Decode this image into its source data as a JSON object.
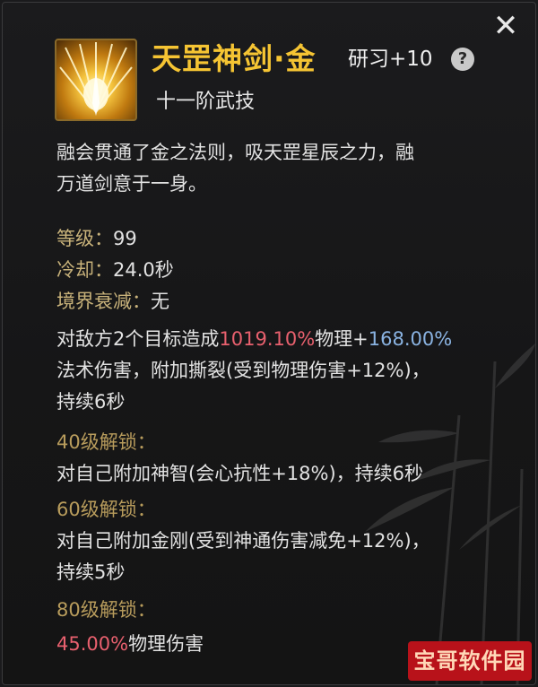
{
  "close_icon": "close-icon",
  "skill": {
    "icon": "golden-sword-burst-icon",
    "name": "天罡神剑·金",
    "research_level": "研习+10",
    "help_symbol": "?",
    "tier": "十一阶武技",
    "description_line1": "融会贯通了金之法则，吸天罡星辰之力，融",
    "description_line2": "万道剑意于一身。"
  },
  "stats": {
    "level_label": "等级：",
    "level_value": "99",
    "cooldown_label": "冷却：",
    "cooldown_value": "24.0秒",
    "realm_decay_label": "境界衰减：",
    "realm_decay_value": "无"
  },
  "effect": {
    "line1_prefix": "对敌方2个目标造成",
    "physical_pct": "1019.10%",
    "line1_mid": "物理+",
    "magic_pct": "168.00%",
    "line2": "法术伤害，附加撕裂(受到物理伤害+12%)，",
    "line3": "持续6秒"
  },
  "unlocks": [
    {
      "label": "40级解锁：",
      "text": "对自己附加神智(会心抗性+18%)，持续6秒",
      "text2": ""
    },
    {
      "label": "60级解锁：",
      "text": "对自己附加金刚(受到神通伤害减免+12%)，",
      "text2": "持续5秒"
    }
  ],
  "unlock80": {
    "label": "80级解锁：",
    "pct": "45.00%",
    "suffix": "物理伤害"
  },
  "watermark": "宝哥软件园",
  "colors": {
    "gold_title": "#f5c433",
    "label_gold": "#c8b27a",
    "red_value": "#e8606e",
    "blue_value": "#8ab3e2",
    "background": "#1a1a1c"
  }
}
